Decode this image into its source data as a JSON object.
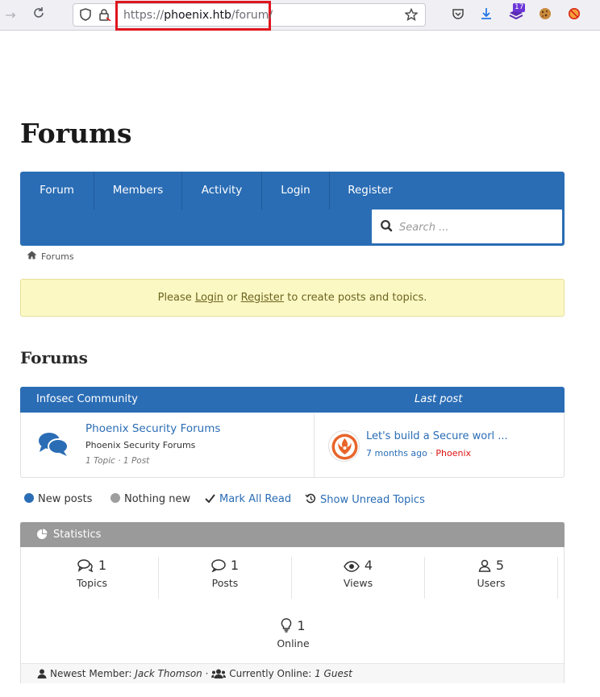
{
  "browser": {
    "url_prefix": "https://",
    "url_host": "phoenix.htb",
    "url_path": "/forum/",
    "extension_badge": "17"
  },
  "site": {
    "title": "Forums"
  },
  "nav": {
    "items": [
      "Forum",
      "Members",
      "Activity",
      "Login",
      "Register"
    ],
    "search_placeholder": "Search ..."
  },
  "breadcrumb": {
    "label": "Forums"
  },
  "notice": {
    "prefix": "Please ",
    "login": "Login",
    "middle": " or ",
    "register": "Register",
    "suffix": " to create posts and topics."
  },
  "section_title": "Forums",
  "forum_table": {
    "category": "Infosec Community",
    "last_post_header": "Last post",
    "forum_name": "Phoenix Security Forums",
    "forum_description": "Phoenix Security Forums",
    "forum_stats": "1 Topic · 1 Post",
    "last_post_title": "Let's build a Secure worl ...",
    "last_post_time": "7 months ago",
    "last_post_sep": " · ",
    "last_post_author": "Phoenix"
  },
  "legend": {
    "new_posts": "New posts",
    "nothing_new": "Nothing new",
    "mark_all_read": "Mark All Read",
    "show_unread": "Show Unread Topics",
    "colors": {
      "new": "#2a6db5",
      "nothing": "#9e9e9e"
    }
  },
  "statistics": {
    "title": "Statistics",
    "topics_value": "1",
    "topics_label": "Topics",
    "posts_value": "1",
    "posts_label": "Posts",
    "views_value": "4",
    "views_label": "Views",
    "users_value": "5",
    "users_label": "Users",
    "online_value": "1",
    "online_label": "Online",
    "newest_label": "Newest Member: ",
    "newest_member": "Jack Thomson",
    "sep": " · ",
    "online_now_label": "Currently Online: ",
    "online_now_value": "1 Guest"
  },
  "colors": {
    "accent": "#2a6db5",
    "notice_bg": "#fcf8c4",
    "stats_header": "#9a9a9a",
    "highlight": "#e0151d"
  }
}
